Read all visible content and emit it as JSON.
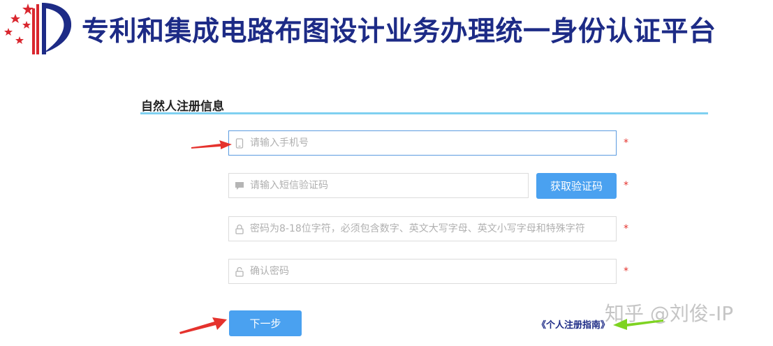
{
  "header": {
    "title": "专利和集成电路布图设计业务办理统一身份认证平台"
  },
  "form": {
    "section_title": "自然人注册信息",
    "phone_placeholder": "请输入手机号",
    "sms_placeholder": "请输入短信验证码",
    "get_code_label": "获取验证码",
    "password_placeholder": "密码为8-18位字符，必须包含数字、英文大写字母、英文小写字母和特殊字符",
    "confirm_placeholder": "确认密码",
    "required_mark": "*",
    "next_label": "下一步"
  },
  "links": {
    "guide": "《个人注册指南》"
  },
  "watermark": "知乎 @刘俊-IP",
  "colors": {
    "title": "#1d2b86",
    "accent_button": "#4aa1f0",
    "section_rule": "#7fd0f0",
    "required": "#e5322d",
    "annotation_red_arrow": "#e5322d",
    "annotation_green_arrow": "#7ed321"
  },
  "icons": {
    "phone_field": "mobile-phone-icon",
    "sms_field": "chat-message-icon",
    "password_field": "lock-icon",
    "confirm_field": "unlock-icon"
  }
}
